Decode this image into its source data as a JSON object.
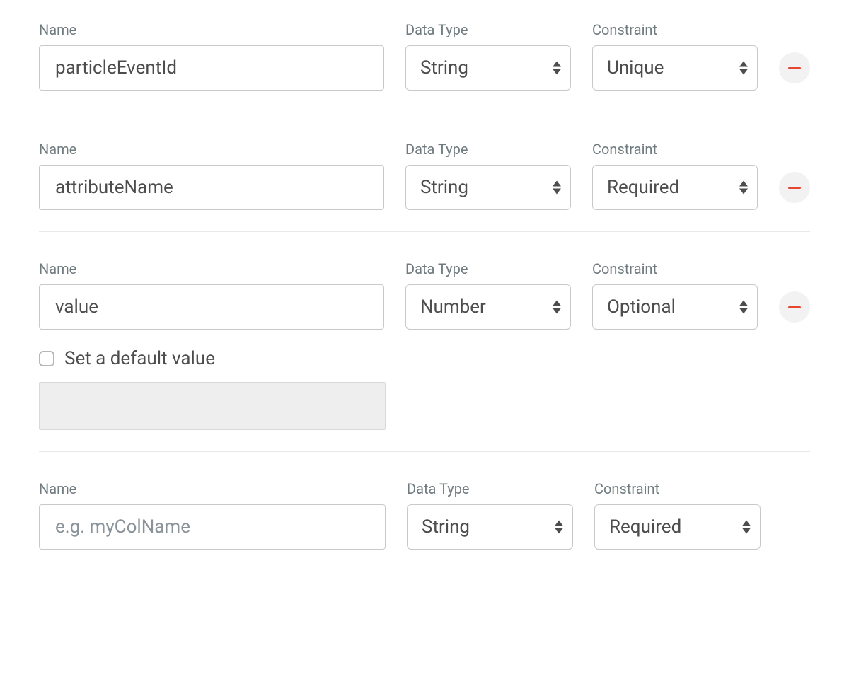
{
  "labels": {
    "name": "Name",
    "data_type": "Data Type",
    "constraint": "Constraint",
    "set_default": "Set a default value"
  },
  "name_placeholder": "e.g. myColName",
  "rows": [
    {
      "name": "particleEventId",
      "data_type": "String",
      "constraint": "Unique",
      "removable": true,
      "show_default": false
    },
    {
      "name": "attributeName",
      "data_type": "String",
      "constraint": "Required",
      "removable": true,
      "show_default": false
    },
    {
      "name": "value",
      "data_type": "Number",
      "constraint": "Optional",
      "removable": true,
      "show_default": true
    },
    {
      "name": "",
      "data_type": "String",
      "constraint": "Required",
      "removable": false,
      "show_default": false
    }
  ]
}
